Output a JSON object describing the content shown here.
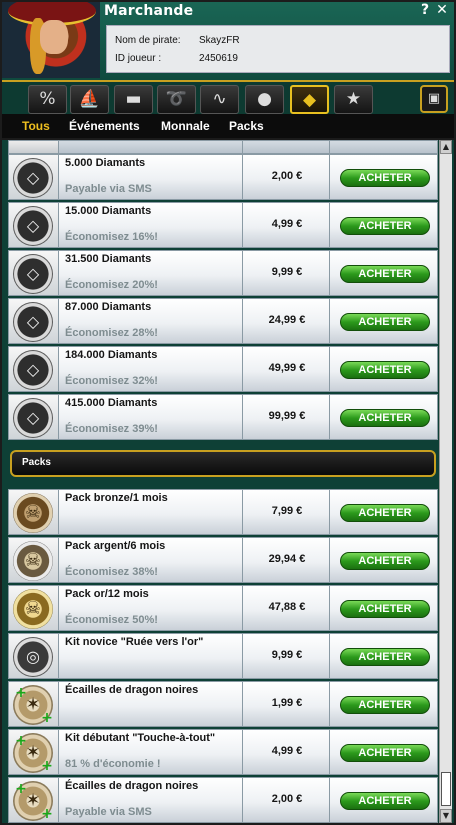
{
  "window": {
    "title": "Marchande",
    "help_label": "?",
    "close_label": "✕"
  },
  "player": {
    "name_label": "Nom de pirate:",
    "name_value": "SkayzFR",
    "id_label": "ID joueur :",
    "id_value": "2450619"
  },
  "tabs": [
    {
      "icon": "percent-icon",
      "glyph": "%"
    },
    {
      "icon": "ship-icon",
      "glyph": "⛵"
    },
    {
      "icon": "cannon-icon",
      "glyph": "▬"
    },
    {
      "icon": "rope-icon",
      "glyph": "➰"
    },
    {
      "icon": "kraken-icon",
      "glyph": "∿"
    },
    {
      "icon": "bomb-icon",
      "glyph": "●"
    },
    {
      "icon": "diamond-icon",
      "glyph": "◆",
      "active": true
    },
    {
      "icon": "star-icon",
      "glyph": "★"
    }
  ],
  "tab_right": {
    "icon": "map-icon",
    "glyph": "▣"
  },
  "subnav": {
    "items": [
      "Tous",
      "Événements",
      "Monnale",
      "Packs"
    ],
    "active_index": 0
  },
  "buy_label": "ACHETER",
  "packs_header": "Packs",
  "diamond_items": [
    {
      "name": "5.000 Diamants",
      "sub": "Payable via SMS",
      "price": "2,00 €",
      "icon": "diamond-icon"
    },
    {
      "name": "15.000 Diamants",
      "sub": "Économisez 16%!",
      "price": "4,99 €",
      "icon": "diamond-icon"
    },
    {
      "name": "31.500 Diamants",
      "sub": "Économisez 20%!",
      "price": "9,99 €",
      "icon": "diamond-icon"
    },
    {
      "name": "87.000 Diamants",
      "sub": "Économisez 28%!",
      "price": "24,99 €",
      "icon": "diamond-icon"
    },
    {
      "name": "184.000 Diamants",
      "sub": "Économisez 32%!",
      "price": "49,99 €",
      "icon": "diamond-icon"
    },
    {
      "name": "415.000 Diamants",
      "sub": "Économisez 39%!",
      "price": "99,99 €",
      "icon": "diamond-icon"
    }
  ],
  "pack_items": [
    {
      "name": "Pack bronze/1 mois",
      "sub": "",
      "price": "7,99 €",
      "icon": "skull-bronze-icon"
    },
    {
      "name": "Pack argent/6 mois",
      "sub": "Économisez 38%!",
      "price": "29,94 €",
      "icon": "skull-silver-icon"
    },
    {
      "name": "Pack or/12 mois",
      "sub": "Économisez 50%!",
      "price": "47,88 €",
      "icon": "skull-gold-icon"
    },
    {
      "name": "Kit novice \"Ruée vers l'or\"",
      "sub": "",
      "price": "9,99 €",
      "icon": "kit-icon"
    },
    {
      "name": "Écailles de dragon noires",
      "sub": "",
      "price": "1,99 €",
      "icon": "compass-plus-icon"
    },
    {
      "name": "Kit débutant \"Touche-à-tout\"",
      "sub": "81 % d'économie !",
      "price": "4,99 €",
      "icon": "compass-plus-icon"
    },
    {
      "name": "Écailles de dragon noires",
      "sub": "Payable via SMS",
      "price": "2,00 €",
      "icon": "compass-plus-icon"
    }
  ],
  "colors": {
    "accent_gold": "#e8c020",
    "buy_green": "#2c9a1c",
    "panel_teal": "#0e4036"
  }
}
